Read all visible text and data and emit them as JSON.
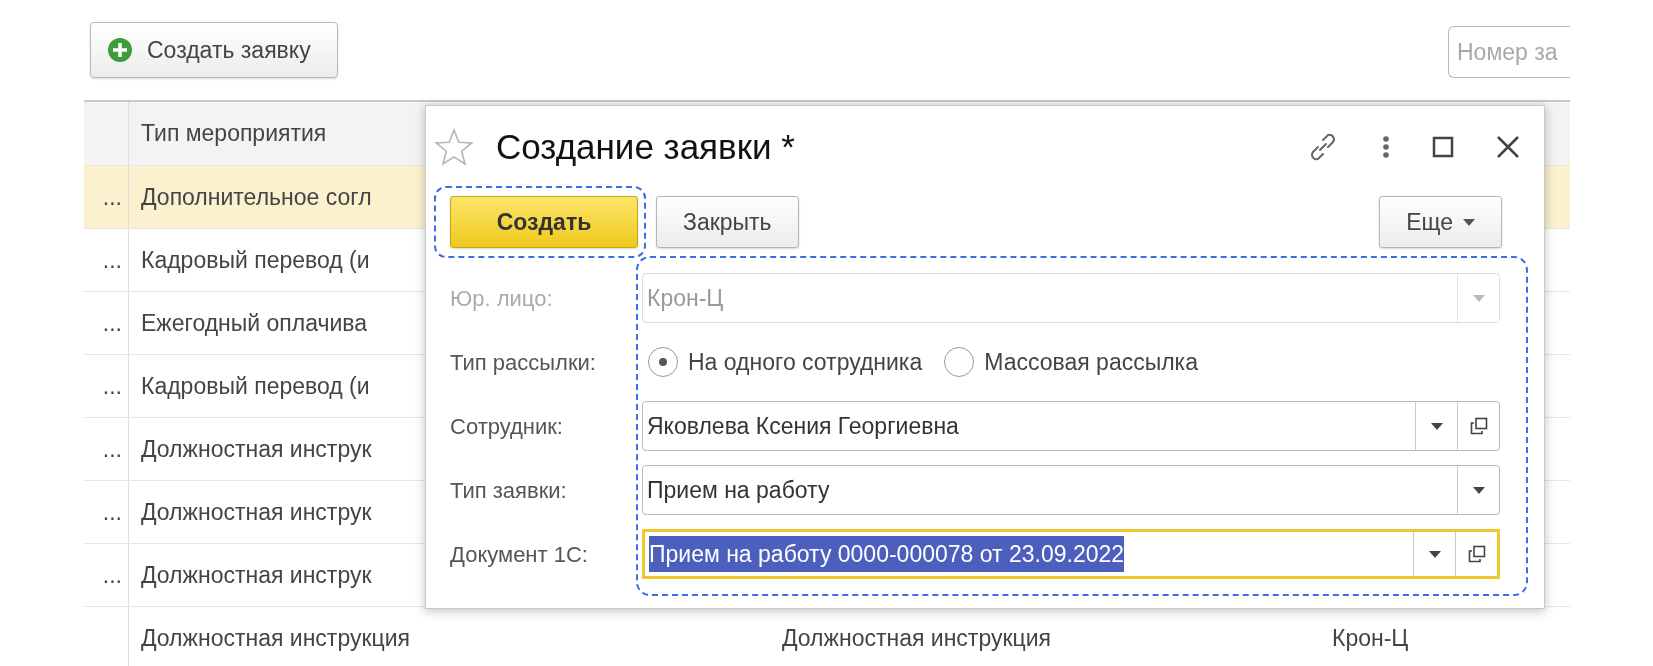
{
  "toolbar": {
    "create_button": "Создать заявку",
    "search": {
      "placeholder": "Номер за"
    }
  },
  "table": {
    "columns": [
      "Тип мероприятия"
    ],
    "rows": [
      {
        "column_1": "...",
        "column_2": "Дополнительное согл",
        "selected": true
      },
      {
        "column_1": "...",
        "column_2": "Кадровый перевод (и",
        "selected": false
      },
      {
        "column_1": "...",
        "column_2": "Ежегодный оплачива",
        "selected": false
      },
      {
        "column_1": "...",
        "column_2": "Кадровый перевод (и",
        "selected": false
      },
      {
        "column_1": "...",
        "column_2": "Должностная инструк",
        "selected": false
      },
      {
        "column_1": "...",
        "column_2": "Должностная инструк",
        "selected": false
      },
      {
        "column_1": "...",
        "column_2": "Должностная инструк",
        "selected": false
      },
      {
        "column_2": "Должностная инструкция",
        "column_3": "Должностная инструкция",
        "column_4": "Крон-Ц",
        "selected": false
      }
    ]
  },
  "dialog": {
    "title": "Создание заявки *",
    "favorite": false,
    "buttons": [
      {
        "label": "Создать",
        "kind": "primary"
      },
      {
        "label": "Закрыть",
        "kind": "default"
      }
    ],
    "more_button": "Еще",
    "fields": [
      {
        "kind": "select",
        "label": "Юр. лицо:",
        "value": "Крон-Ц",
        "disabled": true,
        "open_button": false,
        "focused": false
      },
      {
        "kind": "radio",
        "label": "Тип рассылки:",
        "options": [
          {
            "label": "На одного сотрудника",
            "selected": true
          },
          {
            "label": "Массовая рассылка",
            "selected": false
          }
        ]
      },
      {
        "kind": "select",
        "label": "Сотрудник:",
        "value": "Яковлева Ксения Георгиевна",
        "disabled": false,
        "open_button": true,
        "focused": false
      },
      {
        "kind": "select",
        "label": "Тип заявки:",
        "value": "Прием на работу",
        "disabled": false,
        "open_button": false,
        "focused": false
      },
      {
        "kind": "select",
        "label": "Документ 1С:",
        "value": "Прием на работу 0000-000078 от 23.09.2022",
        "disabled": false,
        "open_button": true,
        "focused": true
      }
    ]
  }
}
